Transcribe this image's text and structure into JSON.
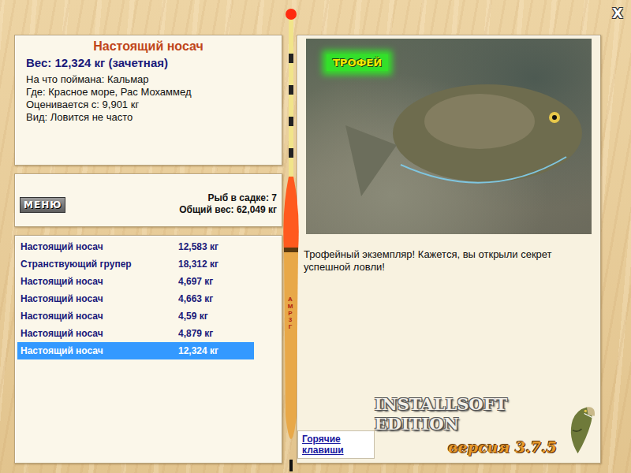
{
  "window": {
    "close": "X"
  },
  "fish": {
    "title": "Настоящий носач",
    "weight": "Вес: 12,324 кг (зачетная)",
    "details": [
      "На что поймана: Кальмар",
      "Где: Красное море, Рас Мохаммед",
      "Оценивается с: 9,901 кг",
      "Вид: Ловится не часто"
    ]
  },
  "keepnet": {
    "menu": "МЕНЮ",
    "count": "Рыб в садке: 7",
    "total": "Общий вес: 62,049 кг"
  },
  "catches": [
    {
      "name": "Настоящий носач",
      "weight": "12,583 кг",
      "selected": false
    },
    {
      "name": "Странствующий групер",
      "weight": "18,312 кг",
      "selected": false
    },
    {
      "name": "Настоящий носач",
      "weight": "4,697 кг",
      "selected": false
    },
    {
      "name": "Настоящий носач",
      "weight": "4,663 кг",
      "selected": false
    },
    {
      "name": "Настоящий носач",
      "weight": "4,59 кг",
      "selected": false
    },
    {
      "name": "Настоящий носач",
      "weight": "4,879 кг",
      "selected": false
    },
    {
      "name": "Настоящий носач",
      "weight": "12,324 кг",
      "selected": true
    }
  ],
  "photo": {
    "badge": "ТРОФЕЙ"
  },
  "message": "Трофейный экземпляр! Кажется, вы открыли секрет успешной ловли!",
  "float": {
    "label": "АМР 3Г"
  },
  "hotkeys": "Горячие клавиши",
  "logo": {
    "title": "INSTALLSOFT EDITION",
    "version": "версия 3.7.5"
  }
}
